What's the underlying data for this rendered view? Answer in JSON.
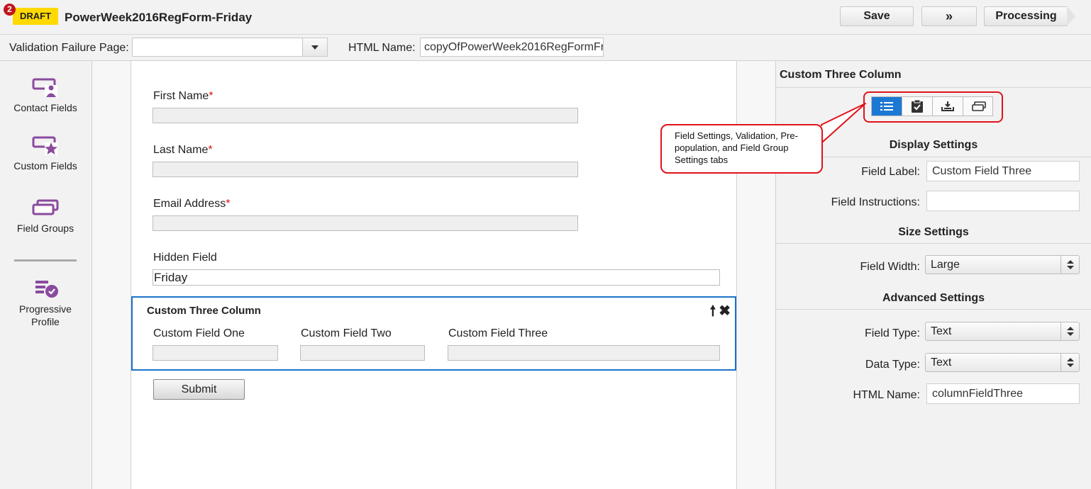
{
  "header": {
    "notification_count": "2",
    "status_badge": "DRAFT",
    "form_name": "PowerWeek2016RegForm-Friday",
    "save_label": "Save",
    "more_label": "»",
    "processing_label": "Processing"
  },
  "settings_row": {
    "validation_failure_label": "Validation Failure Page:",
    "validation_failure_value": "",
    "html_name_label": "HTML Name:",
    "html_name_value": "copyOfPowerWeek2016RegFormFr"
  },
  "sidebar": {
    "items": [
      {
        "label": "Contact Fields",
        "icon": "contact-fields-icon"
      },
      {
        "label": "Custom Fields",
        "icon": "custom-fields-icon"
      },
      {
        "label": "Field Groups",
        "icon": "field-groups-icon"
      },
      {
        "label": "Progressive Profile",
        "icon": "progressive-profile-icon"
      }
    ]
  },
  "form": {
    "fields": [
      {
        "label": "First Name",
        "required": "*"
      },
      {
        "label": "Last Name",
        "required": "*"
      },
      {
        "label": "Email Address",
        "required": "*"
      }
    ],
    "hidden_field": {
      "label": "Hidden Field",
      "value": "Friday"
    },
    "group": {
      "title": "Custom Three Column",
      "move_up": "🠕",
      "remove": "✖",
      "columns": [
        "Custom Field One",
        "Custom Field Two",
        "Custom Field Three"
      ]
    },
    "submit_label": "Submit"
  },
  "callout": {
    "text": "Field Settings, Validation, Pre-population, and Field Group Settings tabs"
  },
  "panel": {
    "title": "Custom Three Column",
    "tabs": [
      {
        "name": "field-settings-tab",
        "icon": "list-icon",
        "active": true
      },
      {
        "name": "validation-tab",
        "icon": "clipboard-check-icon",
        "active": false
      },
      {
        "name": "prepopulation-tab",
        "icon": "tray-download-icon",
        "active": false
      },
      {
        "name": "field-group-settings-tab",
        "icon": "field-group-icon",
        "active": false
      }
    ],
    "display_settings": {
      "heading": "Display Settings",
      "field_label_label": "Field Label:",
      "field_label_value": "Custom Field Three",
      "field_instructions_label": "Field Instructions:",
      "field_instructions_value": ""
    },
    "size_settings": {
      "heading": "Size Settings",
      "field_width_label": "Field Width:",
      "field_width_value": "Large"
    },
    "advanced_settings": {
      "heading": "Advanced Settings",
      "field_type_label": "Field Type:",
      "field_type_value": "Text",
      "data_type_label": "Data Type:",
      "data_type_value": "Text",
      "html_name_label": "HTML Name:",
      "html_name_value": "columnFieldThree"
    }
  },
  "colors": {
    "accent": "#1b78d3",
    "draft_badge": "#ffd900",
    "annotation": "#e0131b",
    "required": "#dd1111",
    "icon_purple": "#8a4a9e"
  }
}
